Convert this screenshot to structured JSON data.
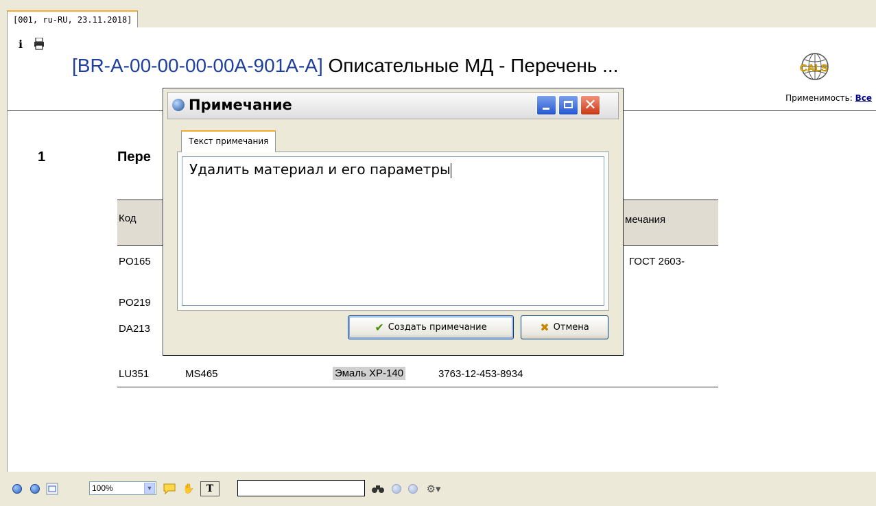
{
  "doc_tab": {
    "label": "[001, ru-RU, 23.11.2018]"
  },
  "page": {
    "toolbar_icons": [
      "info-icon",
      "print-icon"
    ],
    "title_code": "[BR-A-00-00-00-00A-901A-A]",
    "title_text": " Описательные МД - Перечень ...",
    "logo_text": "CALS",
    "applicability_label": "Применимость:",
    "applicability_link": "Все",
    "section_number": "1",
    "section_title": "Пере",
    "table": {
      "col_code": "Код",
      "col_notes": "мечания",
      "rows": [
        {
          "code": "PO165",
          "note": "ГОСТ 2603-"
        },
        {
          "code": "PO219"
        },
        {
          "code": "DA213"
        },
        {
          "code": "LU351",
          "ref": "MS465",
          "name": "Эмаль ХР-140",
          "number": "3763-12-453-8934"
        }
      ]
    }
  },
  "bottom_toolbar": {
    "zoom_value": "100%",
    "search_value": "",
    "icons": [
      "zoom-in-icon",
      "zoom-out-icon",
      "fit-page-icon",
      "zoom-dropdown-icon",
      "comment-icon",
      "hand-tool-icon",
      "text-select-icon",
      "binoculars-icon",
      "prev-result-icon",
      "next-result-icon",
      "settings-icon"
    ]
  },
  "dialog": {
    "title": "Примечание",
    "tab_label": "Текст примечания",
    "note_text": "Удалить материал и его параметры",
    "create_label": "Создать примечание",
    "cancel_label": "Отмена"
  }
}
